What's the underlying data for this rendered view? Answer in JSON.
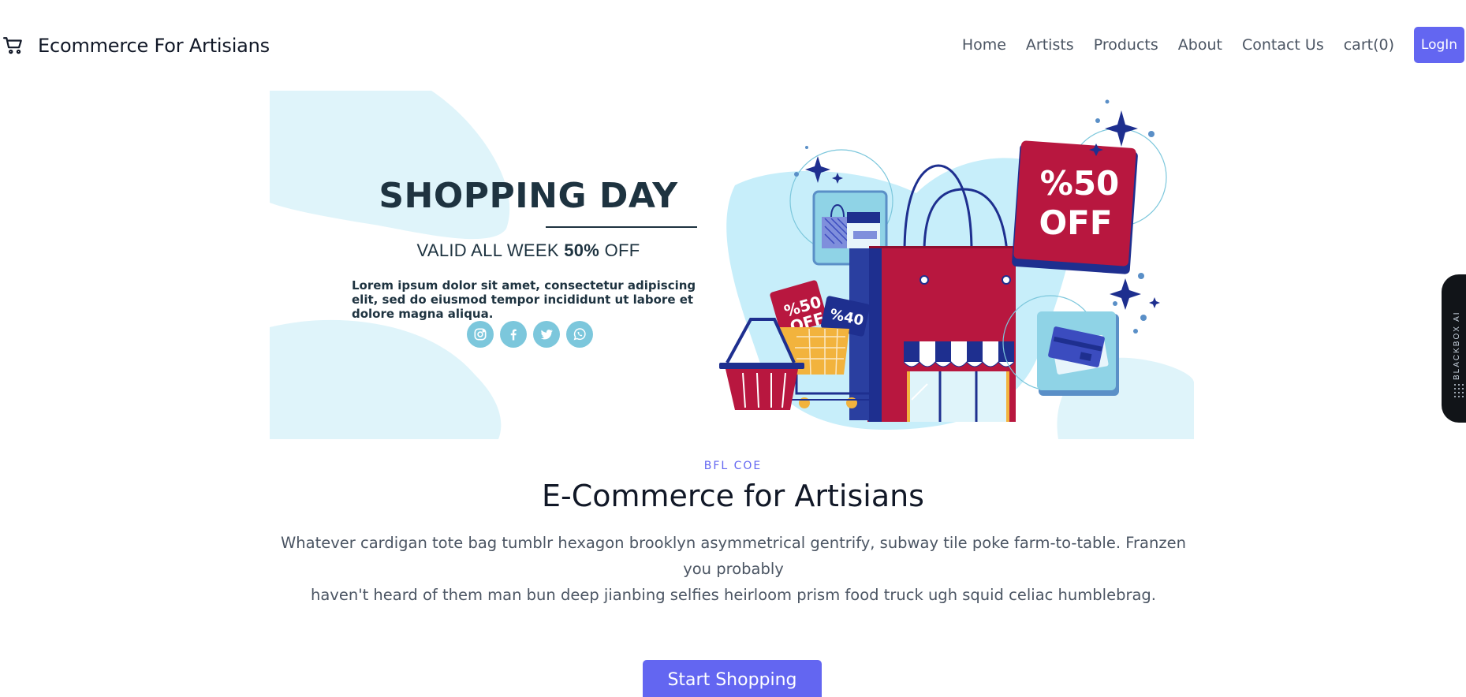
{
  "header": {
    "brand_name": "Ecommerce For Artisians",
    "nav": [
      "Home",
      "Artists",
      "Products",
      "About",
      "Contact Us",
      "cart(0)"
    ],
    "login_label": "LogIn"
  },
  "banner": {
    "title": "SHOPPING DAY",
    "valid_prefix": "VALID ALL WEEK ",
    "valid_bold": "50%",
    "valid_suffix": " OFF",
    "lorem": "Lorem ipsum dolor sit amet, consectetur adipiscing elit, sed do eiusmod tempor incididunt ut labore et dolore magna aliqua.",
    "badge_big_1": "%50",
    "badge_big_2": "OFF",
    "tag_small_1": "%50",
    "tag_small_2": "OFF",
    "tag_small_3": "%40",
    "socials": [
      "instagram-icon",
      "facebook-icon",
      "twitter-icon",
      "whatsapp-icon"
    ]
  },
  "content": {
    "tag": "BFL COE",
    "heading": "E-Commerce for Artisians",
    "description_line1": "Whatever cardigan tote bag tumblr hexagon brooklyn asymmetrical gentrify, subway tile poke farm-to-table. Franzen you probably",
    "description_line2": "haven't heard of them man bun deep jianbing selfies heirloom prism food truck ugh squid celiac humblebrag.",
    "cta_label": "Start Shopping"
  },
  "side_widget": {
    "label": "BLACKBOX AI"
  },
  "colors": {
    "accent": "#6366f1",
    "banner_red": "#b8173f",
    "banner_navy": "#1e2f8f",
    "banner_light": "#dff4fa",
    "banner_text": "#1e3340"
  }
}
